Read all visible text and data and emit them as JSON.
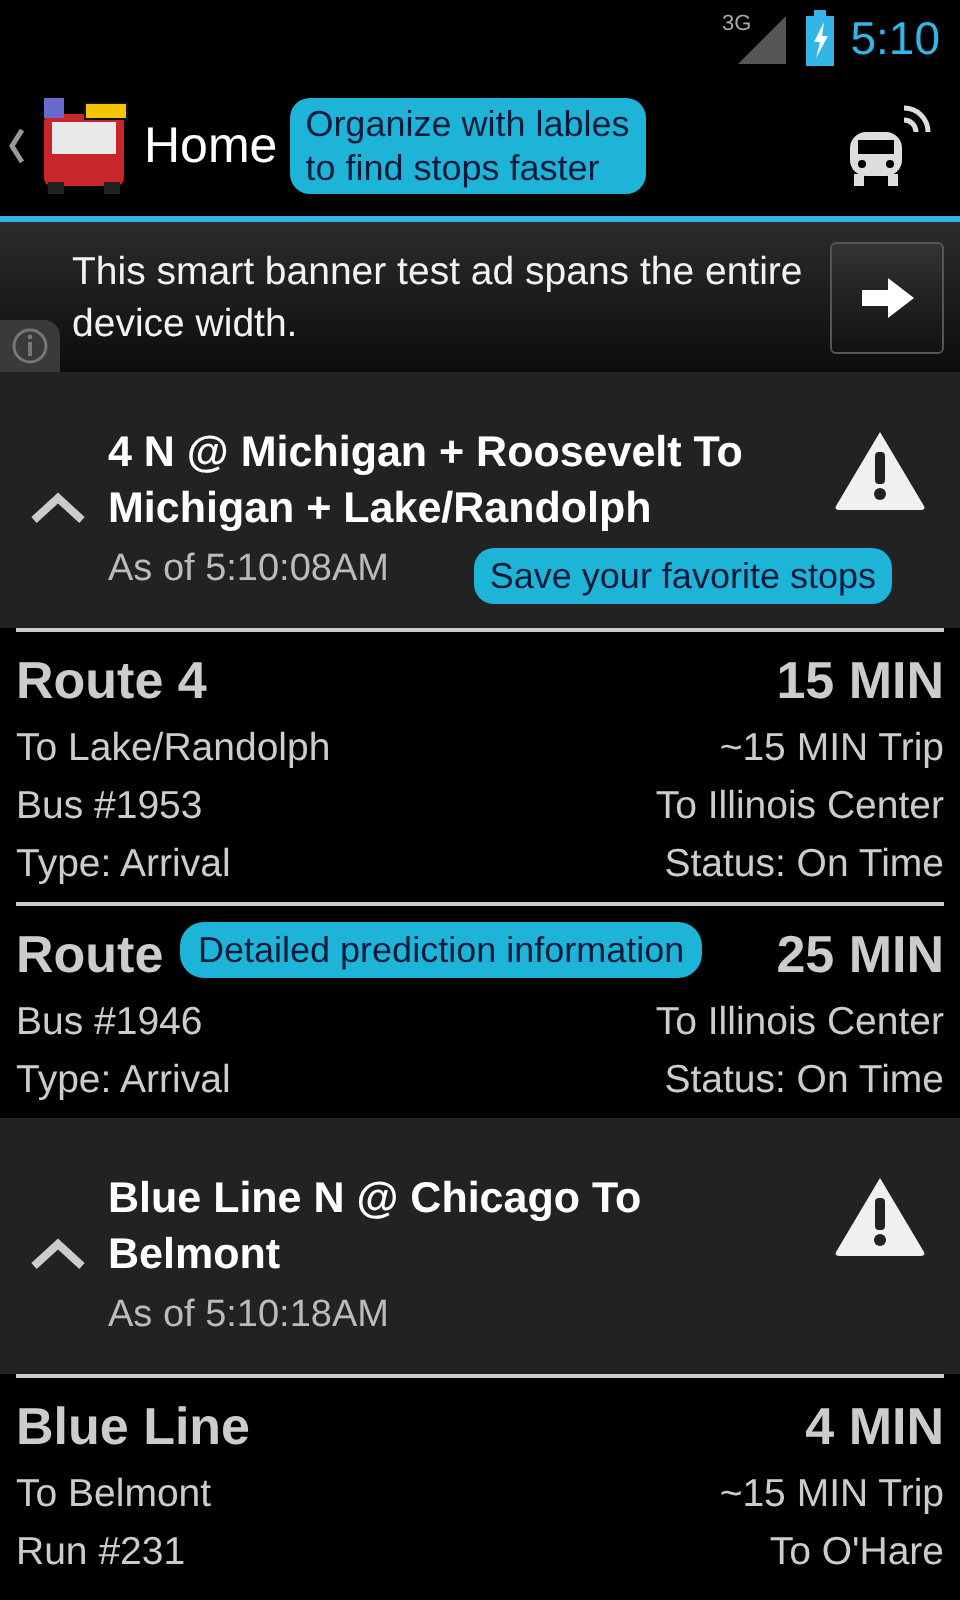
{
  "status_bar": {
    "network": "3G",
    "time": "5:10"
  },
  "action_bar": {
    "title": "Home",
    "tip": "Organize with lables\nto find stops faster"
  },
  "ad": {
    "text": "This smart banner test ad spans the entire device width."
  },
  "stops": [
    {
      "title": "4 N @ Michigan + Roosevelt To Michigan + Lake/Randolph",
      "as_of": "As of 5:10:08AM",
      "expanded": true,
      "tip": "Save your favorite stops",
      "predictions": [
        {
          "title": "Route 4",
          "eta": "15 MIN",
          "rows": [
            {
              "left": "To Lake/Randolph",
              "right": "~15 MIN Trip"
            },
            {
              "left": "Bus #1953",
              "right": "To Illinois Center"
            },
            {
              "left": "Type: Arrival",
              "right": "Status: On Time"
            }
          ]
        },
        {
          "title": "Route",
          "eta": "25 MIN",
          "tip": "Detailed prediction information",
          "rows": [
            {
              "left": "Bus #1946",
              "right": "To Illinois Center"
            },
            {
              "left": "Type: Arrival",
              "right": "Status: On Time"
            }
          ]
        }
      ]
    },
    {
      "title": "Blue Line N @ Chicago To Belmont",
      "as_of": "As of 5:10:18AM",
      "expanded": true,
      "predictions": [
        {
          "title": "Blue Line",
          "eta": "4 MIN",
          "rows": [
            {
              "left": "To Belmont",
              "right": "~15 MIN Trip"
            },
            {
              "left": "Run #231",
              "right": "To O'Hare"
            }
          ]
        }
      ]
    }
  ]
}
